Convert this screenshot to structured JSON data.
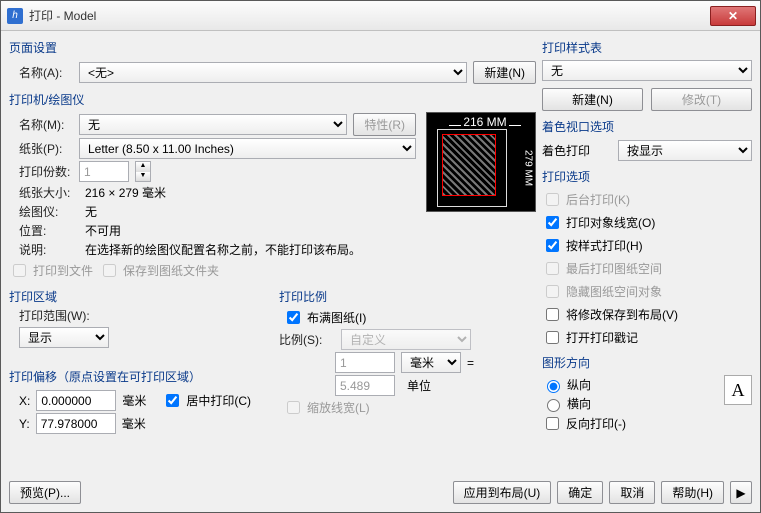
{
  "window": {
    "title": "打印 - Model"
  },
  "page_setup": {
    "group": "页面设置",
    "name_label": "名称(A):",
    "name_value": "<无>",
    "new_btn": "新建(N)"
  },
  "printer": {
    "group": "打印机/绘图仪",
    "name_label": "名称(M):",
    "name_value": "无",
    "props_btn": "特性(R)",
    "paper_label": "纸张(P):",
    "paper_value": "Letter (8.50 x 11.00 Inches)",
    "copies_label": "打印份数:",
    "copies_value": "1",
    "papersize_label": "纸张大小:",
    "papersize_value": "216 × 279 毫米",
    "plotter_label": "绘图仪:",
    "plotter_value": "无",
    "where_label": "位置:",
    "where_value": "不可用",
    "desc_label": "说明:",
    "desc_value": "在选择新的绘图仪配置名称之前，不能打印该布局。",
    "tofile": "打印到文件",
    "savesheet": "保存到图纸文件夹",
    "preview_top": "216 MM",
    "preview_side": "279 MM"
  },
  "area": {
    "group": "打印区域",
    "scope_label": "打印范围(W):",
    "scope_value": "显示"
  },
  "scale": {
    "group": "打印比例",
    "fit": "布满图纸(I)",
    "ratio_label": "比例(S):",
    "ratio_value": "自定义",
    "unit_top": "1",
    "unit_top_label": "毫米",
    "eq": "=",
    "unit_bottom": "5.489",
    "unit_bottom_label": "单位",
    "scale_lw": "缩放线宽(L)"
  },
  "offset": {
    "group": "打印偏移（原点设置在可打印区域）",
    "x_label": "X:",
    "x_value": "0.000000",
    "x_unit": "毫米",
    "center": "居中打印(C)",
    "y_label": "Y:",
    "y_value": "77.978000",
    "y_unit": "毫米"
  },
  "styletable": {
    "group": "打印样式表",
    "value": "无",
    "new_btn": "新建(N)",
    "edit_btn": "修改(T)"
  },
  "viewport": {
    "group": "着色视口选项",
    "shade_label": "着色打印",
    "shade_value": "按显示"
  },
  "options": {
    "group": "打印选项",
    "bg": "后台打印(K)",
    "lw": "打印对象线宽(O)",
    "style": "按样式打印(H)",
    "last_ps": "最后打印图纸空间",
    "hide_ps": "隐藏图纸空间对象",
    "save_layout": "将修改保存到布局(V)",
    "stamp": "打开打印戳记"
  },
  "orient": {
    "group": "图形方向",
    "portrait": "纵向",
    "landscape": "横向",
    "upsidedown": "反向打印(-)",
    "a": "A"
  },
  "footer": {
    "preview": "预览(P)...",
    "apply": "应用到布局(U)",
    "ok": "确定",
    "cancel": "取消",
    "help": "帮助(H)"
  }
}
